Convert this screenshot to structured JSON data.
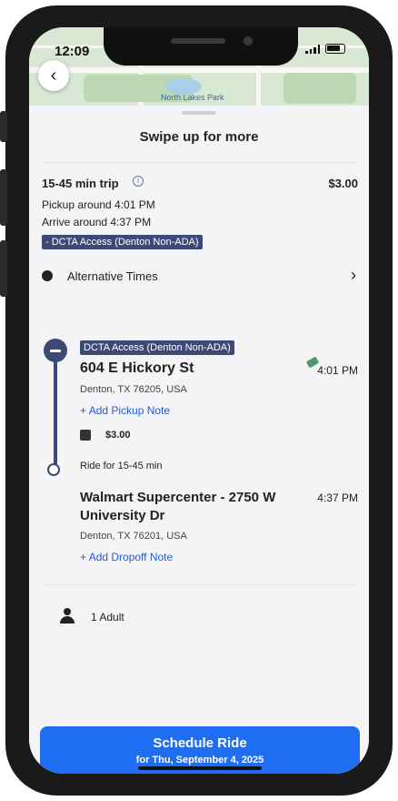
{
  "status": {
    "time": "12:09"
  },
  "map": {
    "label": "North Lakes Park"
  },
  "sheet": {
    "swipe_hint": "Swipe up for more"
  },
  "trip": {
    "duration": "15-45 min trip",
    "price": "$3.00",
    "pickup": "Pickup around 4:01 PM",
    "arrive": "Arrive around 4:37 PM",
    "service_chip": "- DCTA Access (Denton Non-ADA)"
  },
  "alt_times": {
    "label": "Alternative Times"
  },
  "pickup_stop": {
    "service": "DCTA Access (Denton Non-ADA)",
    "name": "604 E Hickory St",
    "address": "Denton, TX 76205, USA",
    "time": "4:01 PM",
    "note_link": "Add Pickup Note",
    "fare": "$3.00",
    "ride_for": "Ride for 15-45 min"
  },
  "dropoff_stop": {
    "name_line1": "Walmart Supercenter - 2750 W",
    "name_line2": "University Dr",
    "address": "Denton, TX 76201, USA",
    "time": "4:37 PM",
    "note_link": "Add Dropoff Note"
  },
  "passengers": {
    "label": "1 Adult"
  },
  "cta": {
    "label": "Schedule Ride",
    "sub": "for Thu, September 4, 2025"
  },
  "colors": {
    "accent": "#1f6ef2",
    "route": "#3c4a77"
  }
}
